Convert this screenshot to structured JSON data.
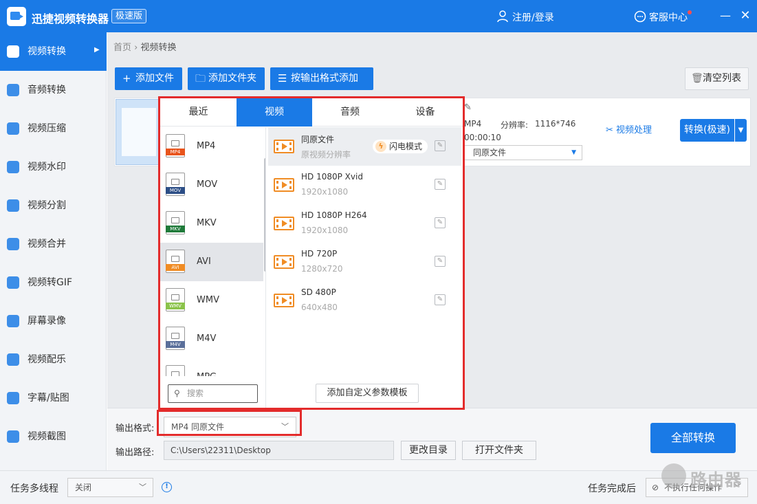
{
  "app": {
    "title": "迅捷视频转换器",
    "edition": "极速版",
    "login": "注册/登录",
    "service": "客服中心",
    "minimize": "—",
    "close": "✕"
  },
  "sidebar": {
    "items": [
      {
        "label": "视频转换",
        "icon": "video-convert-icon",
        "active": true
      },
      {
        "label": "音频转换",
        "icon": "audio-convert-icon"
      },
      {
        "label": "视频压缩",
        "icon": "video-compress-icon"
      },
      {
        "label": "视频水印",
        "icon": "video-watermark-icon"
      },
      {
        "label": "视频分割",
        "icon": "video-split-icon"
      },
      {
        "label": "视频合并",
        "icon": "video-merge-icon"
      },
      {
        "label": "视频转GIF",
        "icon": "video-gif-icon"
      },
      {
        "label": "屏幕录像",
        "icon": "screen-record-icon"
      },
      {
        "label": "视频配乐",
        "icon": "video-music-icon"
      },
      {
        "label": "字幕/贴图",
        "icon": "subtitle-sticker-icon"
      },
      {
        "label": "视频截图",
        "icon": "video-screenshot-icon"
      }
    ]
  },
  "breadcrumb": {
    "home": "首页",
    "separator": "›",
    "current": "视频转换"
  },
  "toolbar": {
    "add_file": "添加文件",
    "add_folder": "添加文件夹",
    "add_by_format": "按输出格式添加",
    "clear_list": "清空列表"
  },
  "file_item": {
    "format": "MP4",
    "resolution_label": "分辨率:",
    "resolution": "1116*746",
    "duration": "00:00:10",
    "output_option": "同原文件",
    "process_label": "视频处理",
    "convert_label": "转换(极速)"
  },
  "format_popup": {
    "tabs": [
      {
        "label": "最近"
      },
      {
        "label": "视频",
        "active": true
      },
      {
        "label": "音频"
      },
      {
        "label": "设备"
      }
    ],
    "formats": [
      {
        "name": "MP4",
        "color": "#e8541c"
      },
      {
        "name": "MOV",
        "color": "#2c4e86"
      },
      {
        "name": "MKV",
        "color": "#1f7a3a"
      },
      {
        "name": "AVI",
        "color": "#f08c24",
        "selected": true
      },
      {
        "name": "WMV",
        "color": "#8bc34a"
      },
      {
        "name": "M4V",
        "color": "#5a6f9a"
      },
      {
        "name": "MPG",
        "color": "#26a69a"
      }
    ],
    "search_placeholder": "搜索",
    "presets": [
      {
        "name": "同原文件",
        "res": "原视频分辨率",
        "flash": "闪电模式",
        "selected": true
      },
      {
        "name": "HD 1080P Xvid",
        "res": "1920x1080"
      },
      {
        "name": "HD 1080P H264",
        "res": "1920x1080"
      },
      {
        "name": "HD 720P",
        "res": "1280x720"
      },
      {
        "name": "SD 480P",
        "res": "640x480"
      }
    ],
    "custom_template": "添加自定义参数模板"
  },
  "output": {
    "format_label": "输出格式:",
    "format_value": "MP4  同原文件",
    "path_label": "输出路径:",
    "path_value": "C:\\Users\\22311\\Desktop",
    "change_dir": "更改目录",
    "open_folder": "打开文件夹",
    "convert_all": "全部转换"
  },
  "statusbar": {
    "multithread_label": "任务多线程",
    "multithread_value": "关闭",
    "after_label": "任务完成后",
    "after_value": "不执行任何操作"
  },
  "watermark": {
    "text": "路由器"
  },
  "colors": {
    "primary": "#1a7ae6",
    "highlight": "#e32b2b",
    "accent": "#f08c24"
  }
}
